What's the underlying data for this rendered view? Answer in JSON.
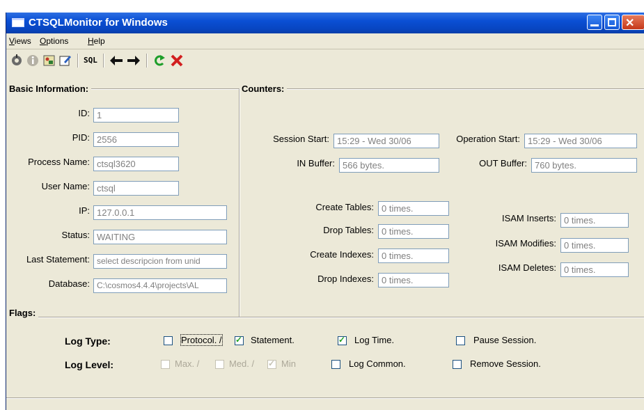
{
  "window": {
    "title": "CTSQLMonitor for Windows"
  },
  "menu": {
    "views": "Views",
    "options": "Options",
    "help": "Help"
  },
  "toolbar": {
    "sql": "SQL",
    "icons": [
      "connect-icon",
      "info-icon",
      "settings-icon",
      "edit-icon",
      "sql-icon",
      "back-arrow-icon",
      "forward-arrow-icon",
      "refresh-icon",
      "close-red-x-icon"
    ]
  },
  "basic": {
    "title": "Basic Information:",
    "id_label": "ID:",
    "id_value": "1",
    "pid_label": "PID:",
    "pid_value": "2556",
    "process_label": "Process Name:",
    "process_value": "ctsql3620",
    "user_label": "User Name:",
    "user_value": "ctsql",
    "ip_label": "IP:",
    "ip_value": "127.0.0.1",
    "status_label": "Status:",
    "status_value": "WAITING",
    "last_label": "Last Statement:",
    "last_value": "select descripcion from unid",
    "db_label": "Database:",
    "db_value": "C:\\cosmos4.4.4\\projects\\AL"
  },
  "counters": {
    "title": "Counters:",
    "session_start_label": "Session Start:",
    "session_start_value": "15:29 - Wed 30/06",
    "operation_start_label": "Operation Start:",
    "operation_start_value": "15:29 - Wed 30/06",
    "in_buffer_label": "IN Buffer:",
    "in_buffer_value": "566 bytes.",
    "out_buffer_label": "OUT Buffer:",
    "out_buffer_value": "760 bytes.",
    "create_tables_label": "Create Tables:",
    "create_tables_value": "0 times.",
    "drop_tables_label": "Drop Tables:",
    "drop_tables_value": "0 times.",
    "create_indexes_label": "Create Indexes:",
    "create_indexes_value": "0 times.",
    "drop_indexes_label": "Drop Indexes:",
    "drop_indexes_value": "0 times.",
    "isam_inserts_label": "ISAM Inserts:",
    "isam_inserts_value": "0 times.",
    "isam_modifies_label": "ISAM Modifies:",
    "isam_modifies_value": "0 times.",
    "isam_deletes_label": "ISAM Deletes:",
    "isam_deletes_value": "0 times."
  },
  "flags": {
    "title": "Flags:",
    "log_type_label": "Log Type:",
    "log_level_label": "Log Level:",
    "protocol": "Protocol. /",
    "protocol_checked": false,
    "statement": "Statement.",
    "statement_checked": true,
    "log_time": "Log Time.",
    "log_time_checked": true,
    "pause_session": "Pause Session.",
    "pause_session_checked": false,
    "max": "Max. /",
    "max_checked": false,
    "med": "Med. /",
    "med_checked": false,
    "min": "Min",
    "min_checked": true,
    "log_common": "Log Common.",
    "log_common_checked": false,
    "remove_session": "Remove Session.",
    "remove_session_checked": false
  },
  "colors": {
    "title_bar": "#0a4fd4",
    "face": "#ece9d8",
    "check": "#21a121",
    "close_x": "#d21f1f",
    "refresh_arrow": "#1e9e2a"
  }
}
